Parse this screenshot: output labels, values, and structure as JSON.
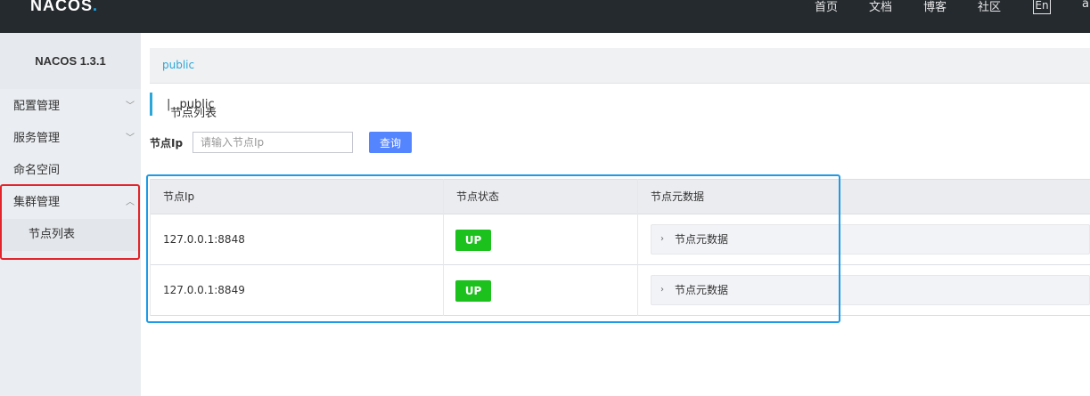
{
  "header": {
    "logo": "NACOS",
    "logo_dot": ".",
    "nav": [
      "首页",
      "文档",
      "博客",
      "社区"
    ],
    "lang": "En",
    "user": "a"
  },
  "sidebar": {
    "title": "NACOS 1.3.1",
    "items": [
      {
        "label": "配置管理",
        "chevron": "﹀"
      },
      {
        "label": "服务管理",
        "chevron": "﹀"
      },
      {
        "label": "命名空间",
        "chevron": ""
      },
      {
        "label": "集群管理",
        "chevron": "︿"
      }
    ],
    "sub_item": "节点列表"
  },
  "namespace_bar": {
    "active": "public"
  },
  "page_header": {
    "title": "节点列表",
    "separator": "|",
    "namespace": "public"
  },
  "filter": {
    "label": "节点Ip",
    "placeholder": "请输入节点Ip",
    "value": "",
    "button": "查询"
  },
  "table": {
    "columns": [
      "节点Ip",
      "节点状态",
      "节点元数据"
    ],
    "rows": [
      {
        "ip": "127.0.0.1:8848",
        "status": "UP",
        "meta": "节点元数据"
      },
      {
        "ip": "127.0.0.1:8849",
        "status": "UP",
        "meta": "节点元数据"
      }
    ]
  },
  "colors": {
    "status_up": "#1dc11d",
    "accent": "#2aa7d8",
    "primary_button": "#5584ff",
    "highlight_red": "#e3242b",
    "highlight_blue": "#1e9be8"
  }
}
